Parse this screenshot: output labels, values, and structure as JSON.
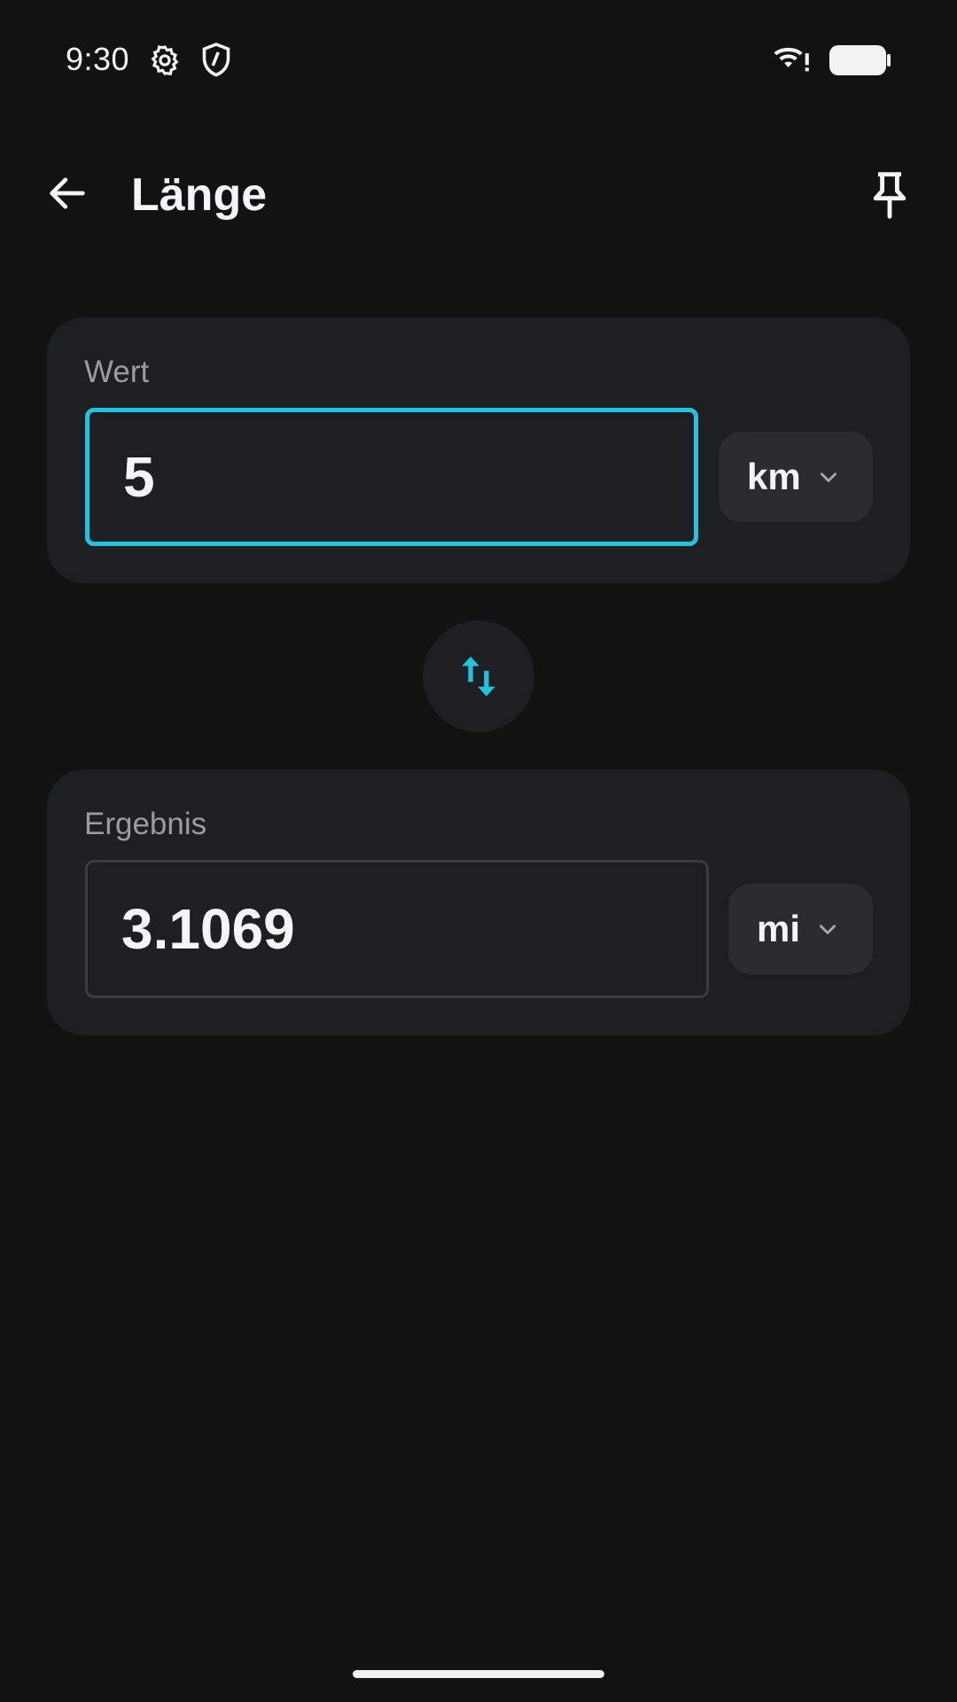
{
  "status_bar": {
    "time": "9:30",
    "icons": [
      "gear-icon",
      "shield-icon",
      "wifi-alert-icon",
      "battery-icon"
    ]
  },
  "app_bar": {
    "title": "Länge",
    "back_icon": "arrow-left-icon",
    "pin_icon": "pin-icon"
  },
  "value_card": {
    "label": "Wert",
    "value": "5",
    "unit": "km"
  },
  "swap": {
    "icon": "swap-vertical-icon"
  },
  "result_card": {
    "label": "Ergebnis",
    "value": "3.1069",
    "unit": "mi"
  },
  "colors": {
    "accent": "#22c3dc",
    "background": "#121212",
    "card": "#1e1f22",
    "unit_chip": "#2a2c30",
    "label": "#9a9ca1"
  }
}
